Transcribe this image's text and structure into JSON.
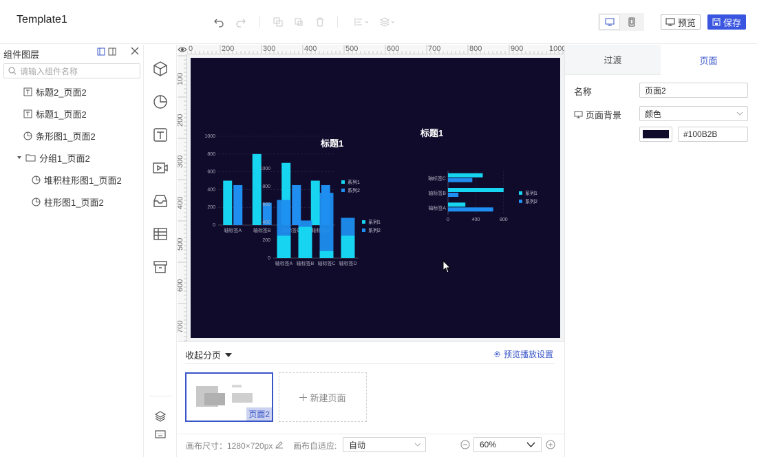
{
  "app": {
    "title": "Template1"
  },
  "toolbar": {
    "preview_label": "预览",
    "save_label": "保存",
    "accent": "#3a55e0"
  },
  "layers": {
    "header": "组件图层",
    "search_placeholder": "请输入组件名称",
    "items": [
      {
        "label": "标题2_页面2",
        "icon": "text-icon"
      },
      {
        "label": "标题1_页面2",
        "icon": "text-icon"
      },
      {
        "label": "条形图1_页面2",
        "icon": "pie-chart-icon"
      },
      {
        "label": "分组1_页面2",
        "icon": "folder-icon"
      },
      {
        "label": "堆积柱形图1_页面2",
        "icon": "pie-chart-icon"
      },
      {
        "label": "柱形图1_页面2",
        "icon": "pie-chart-icon"
      }
    ]
  },
  "ruler": {
    "top": [
      "0",
      "200",
      "300",
      "400",
      "500",
      "600",
      "700",
      "800",
      "900",
      "1000"
    ],
    "left": [
      "100",
      "200",
      "300",
      "400",
      "500",
      "600",
      "700"
    ]
  },
  "canvas": {
    "background": "#100B2B"
  },
  "charts": {
    "title1": "标题1",
    "title2": "标题1",
    "legend_s1": "系列1",
    "legend_s2": "系列2",
    "col_color_s1": "#17d4f0",
    "col_color_s2": "#1f8ef0"
  },
  "chart_data": [
    {
      "type": "bar",
      "categories": [
        "轴标签A",
        "轴标签B",
        "轴标签C",
        "轴标签D"
      ],
      "series": [
        {
          "name": "系列1",
          "values": [
            500,
            800,
            700,
            500
          ]
        },
        {
          "name": "系列2",
          "values": [
            450,
            250,
            450,
            450
          ]
        }
      ],
      "ylim": [
        0,
        1000
      ],
      "yticks": [
        "0",
        "200",
        "400",
        "600",
        "800",
        "1000"
      ]
    },
    {
      "type": "bar",
      "stacked": true,
      "categories": [
        "轴标签A",
        "轴标签B",
        "轴标签C",
        "轴标签D"
      ],
      "series": [
        {
          "name": "系列1",
          "values": [
            250,
            350,
            80,
            250
          ]
        },
        {
          "name": "系列2",
          "values": [
            400,
            70,
            650,
            200
          ]
        }
      ],
      "ylim": [
        0,
        1000
      ],
      "yticks": [
        "0",
        "200",
        "400",
        "600",
        "800",
        "1000"
      ]
    },
    {
      "type": "bar",
      "orientation": "horizontal",
      "categories": [
        "轴标签A",
        "轴标签B",
        "轴标签C"
      ],
      "series": [
        {
          "name": "系列1",
          "values": [
            250,
            800,
            500
          ]
        },
        {
          "name": "系列2",
          "values": [
            650,
            150,
            350
          ]
        }
      ],
      "xlim": [
        0,
        1000
      ],
      "xticks": [
        "0",
        "400",
        "800"
      ]
    }
  ],
  "pages": {
    "collapse_label": "收起分页",
    "play_settings_label": "预览播放设置",
    "current_page_label": "页面2",
    "new_page_label": "新建页面"
  },
  "footer": {
    "size_label": "画布尺寸：1280×720px",
    "fit_label": "画布自适应:",
    "fit_value": "自动",
    "zoom_value": "60%"
  },
  "props": {
    "tab_transition": "过渡",
    "tab_page": "页面",
    "name_label": "名称",
    "name_value": "页面2",
    "bg_label": "页面背景",
    "bg_type": "颜色",
    "bg_color": "#100B2B"
  }
}
